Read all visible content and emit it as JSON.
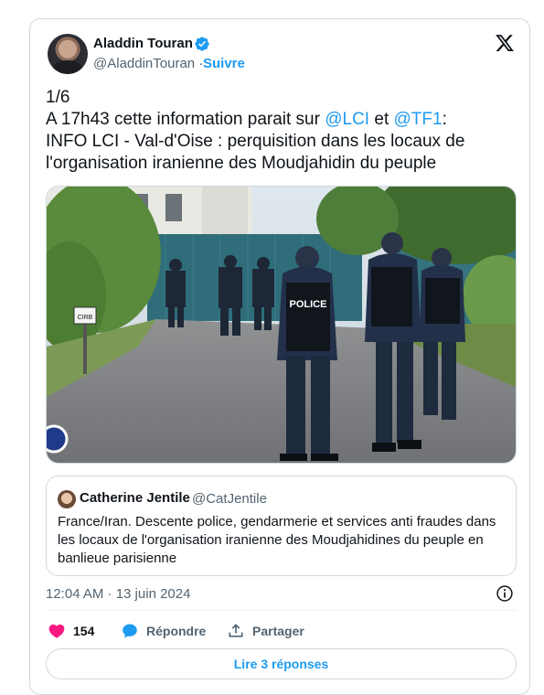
{
  "author": {
    "name": "Aladdin Touran",
    "handle": "@AladdinTouran",
    "separator": "·",
    "follow_label": "Suivre"
  },
  "tweet": {
    "line1": "1/6",
    "line2_prefix": "A 17h43 cette information parait sur ",
    "mention1": "@LCI",
    "line2_middle": " et ",
    "mention2": "@TF1",
    "line2_suffix": ":",
    "line3": "INFO LCI - Val-d'Oise : perquisition dans les locaux de",
    "line4": "l'organisation iranienne des Moudjahidin du peuple"
  },
  "photo": {
    "vest_label": "POLICE",
    "sign_text": "CIRB"
  },
  "quote": {
    "name": "Catherine Jentile",
    "handle": "@CatJentile",
    "text": "France/Iran. Descente police, gendarmerie et services anti fraudes dans les locaux de l'organisation iranienne des Moudjahidines du peuple en banlieue parisienne"
  },
  "timestamp": "12:04 AM · 13 juin 2024",
  "actions": {
    "like_count": "154",
    "reply_label": "Répondre",
    "share_label": "Partager"
  },
  "replies_button_label": "Lire 3 réponses",
  "colors": {
    "accent": "#1d9bf0",
    "like": "#f91880",
    "secondary_text": "#536471",
    "border": "#cfd9de"
  }
}
